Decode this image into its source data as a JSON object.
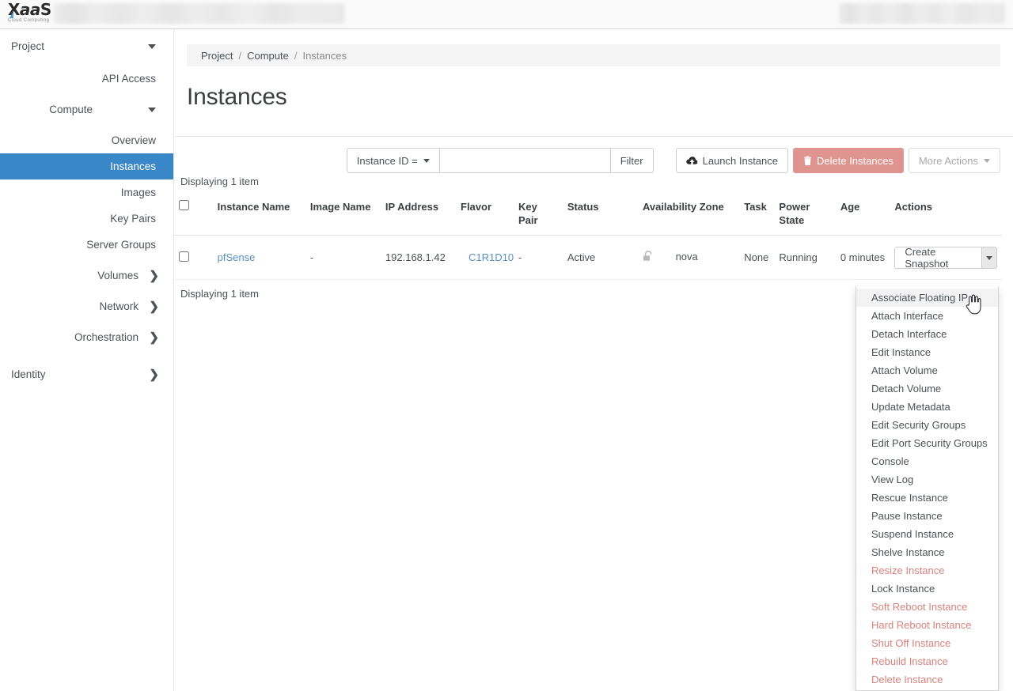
{
  "brand": {
    "name_1": "X",
    "name_2": "aa",
    "name_3": "S",
    "tagline": "Cloud Computing"
  },
  "header": {
    "redacted_left": "",
    "redacted_right": ""
  },
  "sidebar": {
    "items": [
      {
        "label": "Project",
        "level": "top",
        "icon": "chevron-down-icon",
        "active": false
      },
      {
        "label": "API Access",
        "level": "leaf",
        "icon": "",
        "active": false
      },
      {
        "label": "Compute",
        "level": "sub",
        "icon": "chevron-down-icon",
        "active": false
      },
      {
        "label": "Overview",
        "level": "leaf",
        "icon": "",
        "active": false
      },
      {
        "label": "Instances",
        "level": "leaf",
        "icon": "",
        "active": true
      },
      {
        "label": "Images",
        "level": "leaf",
        "icon": "",
        "active": false
      },
      {
        "label": "Key Pairs",
        "level": "leaf",
        "icon": "",
        "active": false
      },
      {
        "label": "Server Groups",
        "level": "leaf",
        "icon": "",
        "active": false
      },
      {
        "label": "Volumes",
        "level": "sub",
        "icon": "chevron-right-icon",
        "active": false
      },
      {
        "label": "Network",
        "level": "sub",
        "icon": "chevron-right-icon",
        "active": false
      },
      {
        "label": "Orchestration",
        "level": "sub",
        "icon": "chevron-right-icon",
        "active": false
      },
      {
        "label": "Identity",
        "level": "top",
        "icon": "chevron-right-icon",
        "active": false
      }
    ]
  },
  "breadcrumb": {
    "item1": "Project",
    "item2": "Compute",
    "current": "Instances",
    "separator": "/"
  },
  "page": {
    "title": "Instances"
  },
  "toolbar": {
    "filter_select_label": "Instance ID =",
    "filter_input_value": "",
    "filter_input_placeholder": "",
    "filter_button": "Filter",
    "launch_instance": "Launch Instance",
    "delete_instances": "Delete Instances",
    "more_actions": "More Actions",
    "launch_icon": "cloud-upload-icon",
    "delete_icon": "trash-icon",
    "delete_color": "#e09490"
  },
  "table": {
    "count_top": "Displaying 1 item",
    "count_bottom": "Displaying 1 item",
    "columns": [
      "Instance Name",
      "Image Name",
      "IP Address",
      "Flavor",
      "Key Pair",
      "Status",
      "Availability Zone",
      "Task",
      "Power State",
      "Age",
      "Actions"
    ],
    "rows": [
      {
        "instance_name": "pfSense",
        "image_name": "-",
        "ip_address": "192.168.1.42",
        "flavor": "C1R1D10",
        "key_pair": "-",
        "status": "Active",
        "lock_icon": "unlock-icon",
        "availability_zone": "nova",
        "task": "None",
        "power_state": "Running",
        "age": "0 minutes",
        "action_primary": "Create Snapshot",
        "action_toggle_icon": "caret-down-icon"
      }
    ]
  },
  "actions_menu": {
    "items": [
      {
        "label": "Associate Floating IP",
        "danger": false,
        "hover": true
      },
      {
        "label": "Attach Interface",
        "danger": false,
        "hover": false
      },
      {
        "label": "Detach Interface",
        "danger": false,
        "hover": false
      },
      {
        "label": "Edit Instance",
        "danger": false,
        "hover": false
      },
      {
        "label": "Attach Volume",
        "danger": false,
        "hover": false
      },
      {
        "label": "Detach Volume",
        "danger": false,
        "hover": false
      },
      {
        "label": "Update Metadata",
        "danger": false,
        "hover": false
      },
      {
        "label": "Edit Security Groups",
        "danger": false,
        "hover": false
      },
      {
        "label": "Edit Port Security Groups",
        "danger": false,
        "hover": false
      },
      {
        "label": "Console",
        "danger": false,
        "hover": false
      },
      {
        "label": "View Log",
        "danger": false,
        "hover": false
      },
      {
        "label": "Rescue Instance",
        "danger": false,
        "hover": false
      },
      {
        "label": "Pause Instance",
        "danger": false,
        "hover": false
      },
      {
        "label": "Suspend Instance",
        "danger": false,
        "hover": false
      },
      {
        "label": "Shelve Instance",
        "danger": false,
        "hover": false
      },
      {
        "label": "Resize Instance",
        "danger": true,
        "hover": false
      },
      {
        "label": "Lock Instance",
        "danger": false,
        "hover": false
      },
      {
        "label": "Soft Reboot Instance",
        "danger": true,
        "hover": false
      },
      {
        "label": "Hard Reboot Instance",
        "danger": true,
        "hover": false
      },
      {
        "label": "Shut Off Instance",
        "danger": true,
        "hover": false
      },
      {
        "label": "Rebuild Instance",
        "danger": true,
        "hover": false
      },
      {
        "label": "Delete Instance",
        "danger": true,
        "hover": false
      }
    ],
    "danger_color": "#d8827d"
  },
  "colors": {
    "accent": "#3a87c8",
    "link": "#5a8fc0",
    "danger": "#d8827d"
  },
  "cursor": {
    "icon": "pointer-hand-cursor"
  }
}
